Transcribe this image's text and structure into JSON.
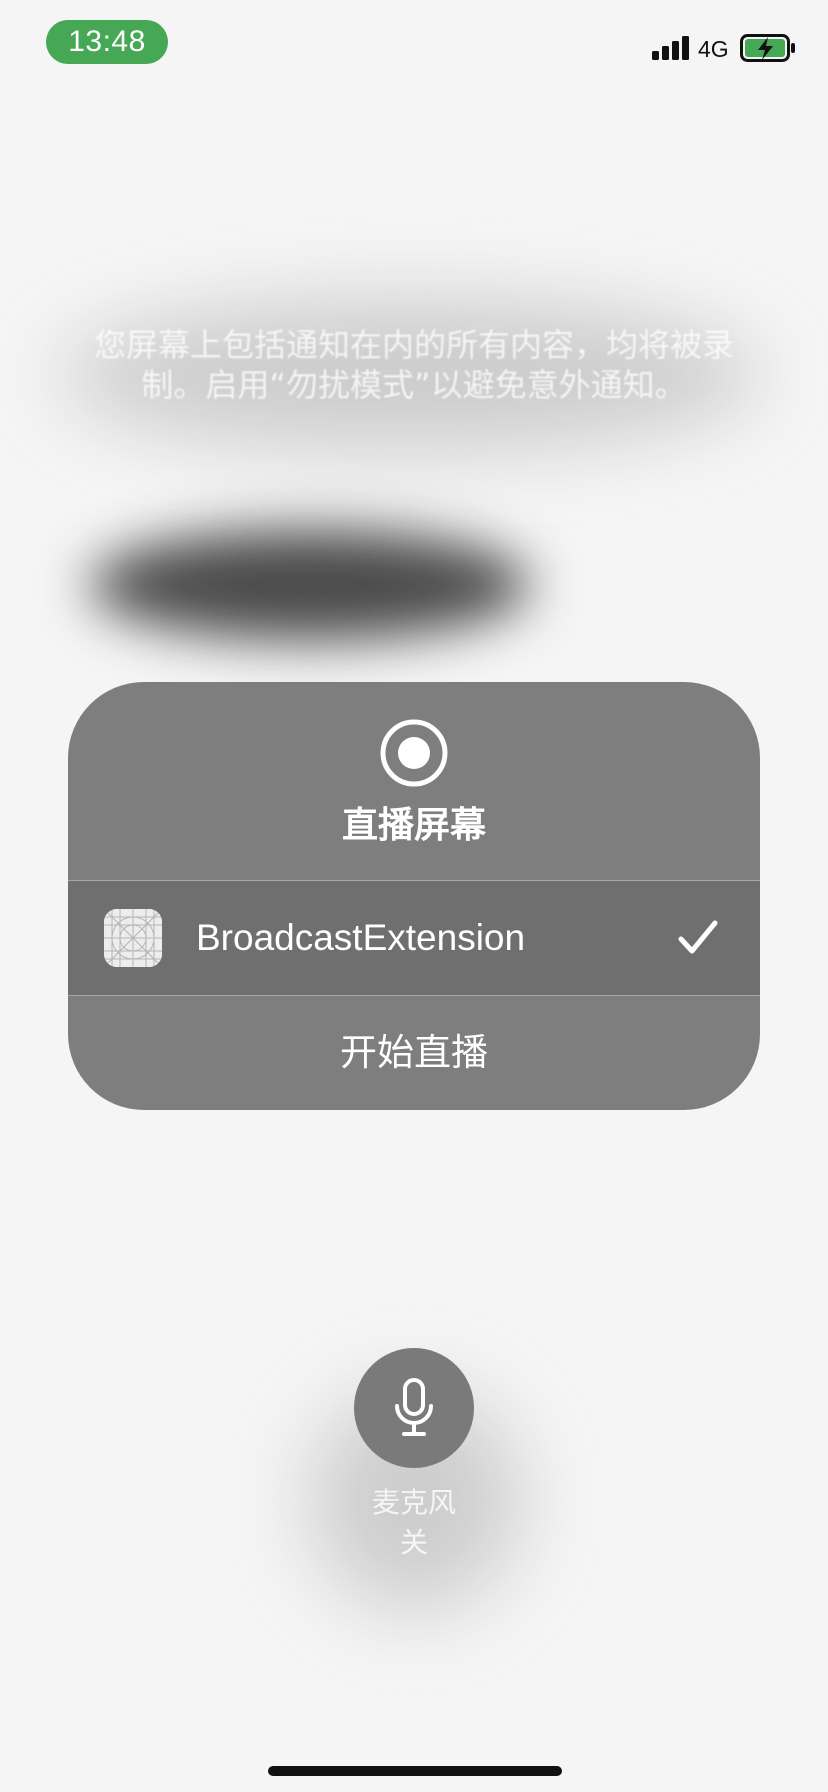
{
  "status_bar": {
    "time": "13:48",
    "network": "4G",
    "time_pill_color": "#46a855",
    "battery_color": "#46a855",
    "battery_state": "charging"
  },
  "notice": {
    "text": "您屏幕上包括通知在内的所有内容，均将被录制。启用“勿扰模式”以避免意外通知。"
  },
  "broadcast_sheet": {
    "icon": "record-icon",
    "title": "直播屏幕",
    "extension": {
      "icon": "app-placeholder-icon",
      "label": "BroadcastExtension",
      "selected": true,
      "selected_icon": "checkmark-icon"
    },
    "start_label": "开始直播"
  },
  "microphone": {
    "icon": "microphone-icon",
    "label": "麦克风",
    "state": "关"
  }
}
